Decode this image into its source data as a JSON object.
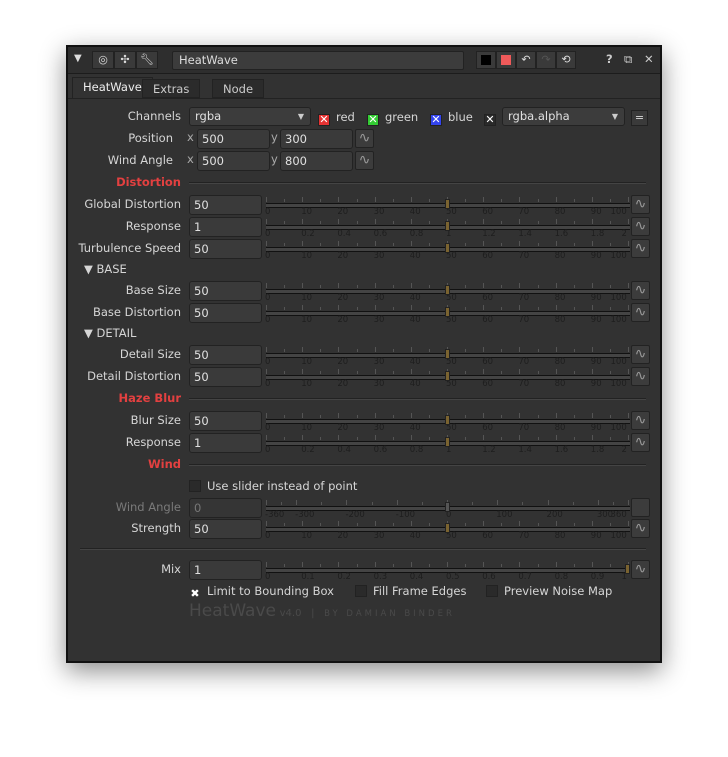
{
  "title_bar": {
    "node_name": "HeatWave",
    "help": "?",
    "float": "⧉",
    "close": "✕",
    "collapse": "▼"
  },
  "tabs": [
    "HeatWave",
    "Extras",
    "Node"
  ],
  "channels": {
    "label": "Channels",
    "value": "rgba",
    "red": "red",
    "green": "green",
    "blue": "blue",
    "alpha_value": "rgba.alpha",
    "eq": "=",
    "colors": {
      "red": "#e53333",
      "green": "#33cc33",
      "blue": "#3344ee"
    }
  },
  "position": {
    "label": "Position",
    "x_label": "x",
    "x": "500",
    "y_label": "y",
    "y": "300"
  },
  "wind_angle_xy": {
    "label": "Wind Angle",
    "x_label": "x",
    "x": "500",
    "y_label": "y",
    "y": "800"
  },
  "sections": {
    "distortion": "Distortion",
    "base": "BASE",
    "detail": "DETAIL",
    "haze_blur": "Haze Blur",
    "wind": "Wind"
  },
  "params": [
    {
      "label": "Global Distortion",
      "value": "50",
      "min": 0,
      "max": 100,
      "num": 50,
      "ticks": [
        "0",
        "10",
        "20",
        "30",
        "40",
        "50",
        "60",
        "70",
        "80",
        "90",
        "100"
      ]
    },
    {
      "label": "Response",
      "value": "1",
      "min": 0,
      "max": 2,
      "num": 1,
      "ticks": [
        "0",
        "0.2",
        "0.4",
        "0.6",
        "0.8",
        "1",
        "1.2",
        "1.4",
        "1.6",
        "1.8",
        "2"
      ]
    },
    {
      "label": "Turbulence Speed",
      "value": "50",
      "min": 0,
      "max": 100,
      "num": 50,
      "ticks": [
        "0",
        "10",
        "20",
        "30",
        "40",
        "50",
        "60",
        "70",
        "80",
        "90",
        "100"
      ]
    },
    {
      "label": "Base Size",
      "value": "50",
      "min": 0,
      "max": 100,
      "num": 50,
      "ticks": [
        "0",
        "10",
        "20",
        "30",
        "40",
        "50",
        "60",
        "70",
        "80",
        "90",
        "100"
      ]
    },
    {
      "label": "Base Distortion",
      "value": "50",
      "min": 0,
      "max": 100,
      "num": 50,
      "ticks": [
        "0",
        "10",
        "20",
        "30",
        "40",
        "50",
        "60",
        "70",
        "80",
        "90",
        "100"
      ]
    },
    {
      "label": "Detail Size",
      "value": "50",
      "min": 0,
      "max": 100,
      "num": 50,
      "ticks": [
        "0",
        "10",
        "20",
        "30",
        "40",
        "50",
        "60",
        "70",
        "80",
        "90",
        "100"
      ]
    },
    {
      "label": "Detail Distortion",
      "value": "50",
      "min": 0,
      "max": 100,
      "num": 50,
      "ticks": [
        "0",
        "10",
        "20",
        "30",
        "40",
        "50",
        "60",
        "70",
        "80",
        "90",
        "100"
      ]
    },
    {
      "label": "Blur Size",
      "value": "50",
      "min": 0,
      "max": 100,
      "num": 50,
      "ticks": [
        "0",
        "10",
        "20",
        "30",
        "40",
        "50",
        "60",
        "70",
        "80",
        "90",
        "100"
      ]
    },
    {
      "label": "Response",
      "value": "1",
      "min": 0,
      "max": 2,
      "num": 1,
      "ticks": [
        "0",
        "0.2",
        "0.4",
        "0.6",
        "0.8",
        "1",
        "1.2",
        "1.4",
        "1.6",
        "1.8",
        "2"
      ]
    },
    {
      "label": "Wind Angle",
      "value": "0",
      "min": -360,
      "max": 360,
      "num": 0,
      "disabled": true,
      "ticks": [
        "-360",
        "-300",
        "-200",
        "-100",
        "0",
        "100",
        "200",
        "300",
        "360"
      ]
    },
    {
      "label": "Strength",
      "value": "50",
      "min": 0,
      "max": 100,
      "num": 50,
      "ticks": [
        "0",
        "10",
        "20",
        "30",
        "40",
        "50",
        "60",
        "70",
        "80",
        "90",
        "100"
      ]
    },
    {
      "label": "Mix",
      "value": "1",
      "min": 0,
      "max": 1,
      "num": 1,
      "ticks": [
        "0",
        "0.1",
        "0.2",
        "0.3",
        "0.4",
        "0.5",
        "0.6",
        "0.7",
        "0.8",
        "0.9",
        "1"
      ]
    }
  ],
  "use_slider": {
    "label": "Use slider instead of point",
    "checked": false
  },
  "options": [
    {
      "label": "Limit to Bounding Box",
      "checked": true
    },
    {
      "label": "Fill Frame Edges",
      "checked": false
    },
    {
      "label": "Preview Noise Map",
      "checked": false
    }
  ],
  "footer": {
    "name": "HeatWave",
    "version": "v4.0",
    "sep": "|",
    "author": "BY DAMIAN BINDER"
  }
}
